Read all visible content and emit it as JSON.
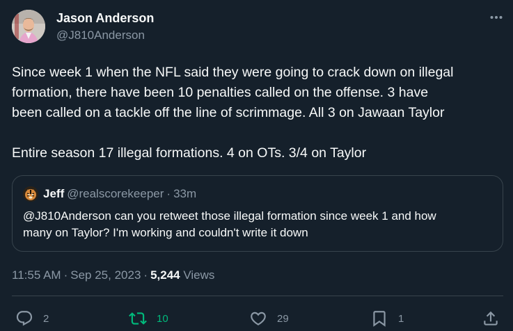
{
  "author": {
    "name": "Jason Anderson",
    "handle": "@J810Anderson"
  },
  "body": {
    "paragraph1": [
      "Since week 1 when the NFL said they were going to crack down on illegal",
      "formation, there have been 10 penalties called on the offense. 3 have",
      "been called on a tackle off the line of scrimmage. All 3 on Jawaan Taylor"
    ],
    "paragraph2": "Entire season 17 illegal formations. 4 on OTs. 3/4 on Taylor"
  },
  "quote": {
    "name": "Jeff",
    "handle": "@realscorekeeper",
    "separator": "·",
    "time": "33m",
    "lines": [
      "@J810Anderson can you retweet those illegal formation since week 1 and how",
      "many on Taylor? I'm working and couldn't write it down"
    ]
  },
  "meta": {
    "time": "11:55 AM",
    "separator": "·",
    "date": "Sep 25, 2023",
    "views_count": "5,244",
    "views_label": "Views"
  },
  "actions": {
    "replies": "2",
    "retweets": "10",
    "likes": "29",
    "bookmarks": "1"
  },
  "icons": {
    "more": "more-horizontal-icon",
    "reply": "reply-icon",
    "retweet": "retweet-icon",
    "like": "heart-icon",
    "bookmark": "bookmark-icon",
    "share": "share-icon"
  },
  "colors": {
    "background": "#15202b",
    "text_primary": "#f7f9f9",
    "text_secondary": "#8b98a5",
    "border": "#38444d",
    "retweet_active": "#00ba7c"
  }
}
